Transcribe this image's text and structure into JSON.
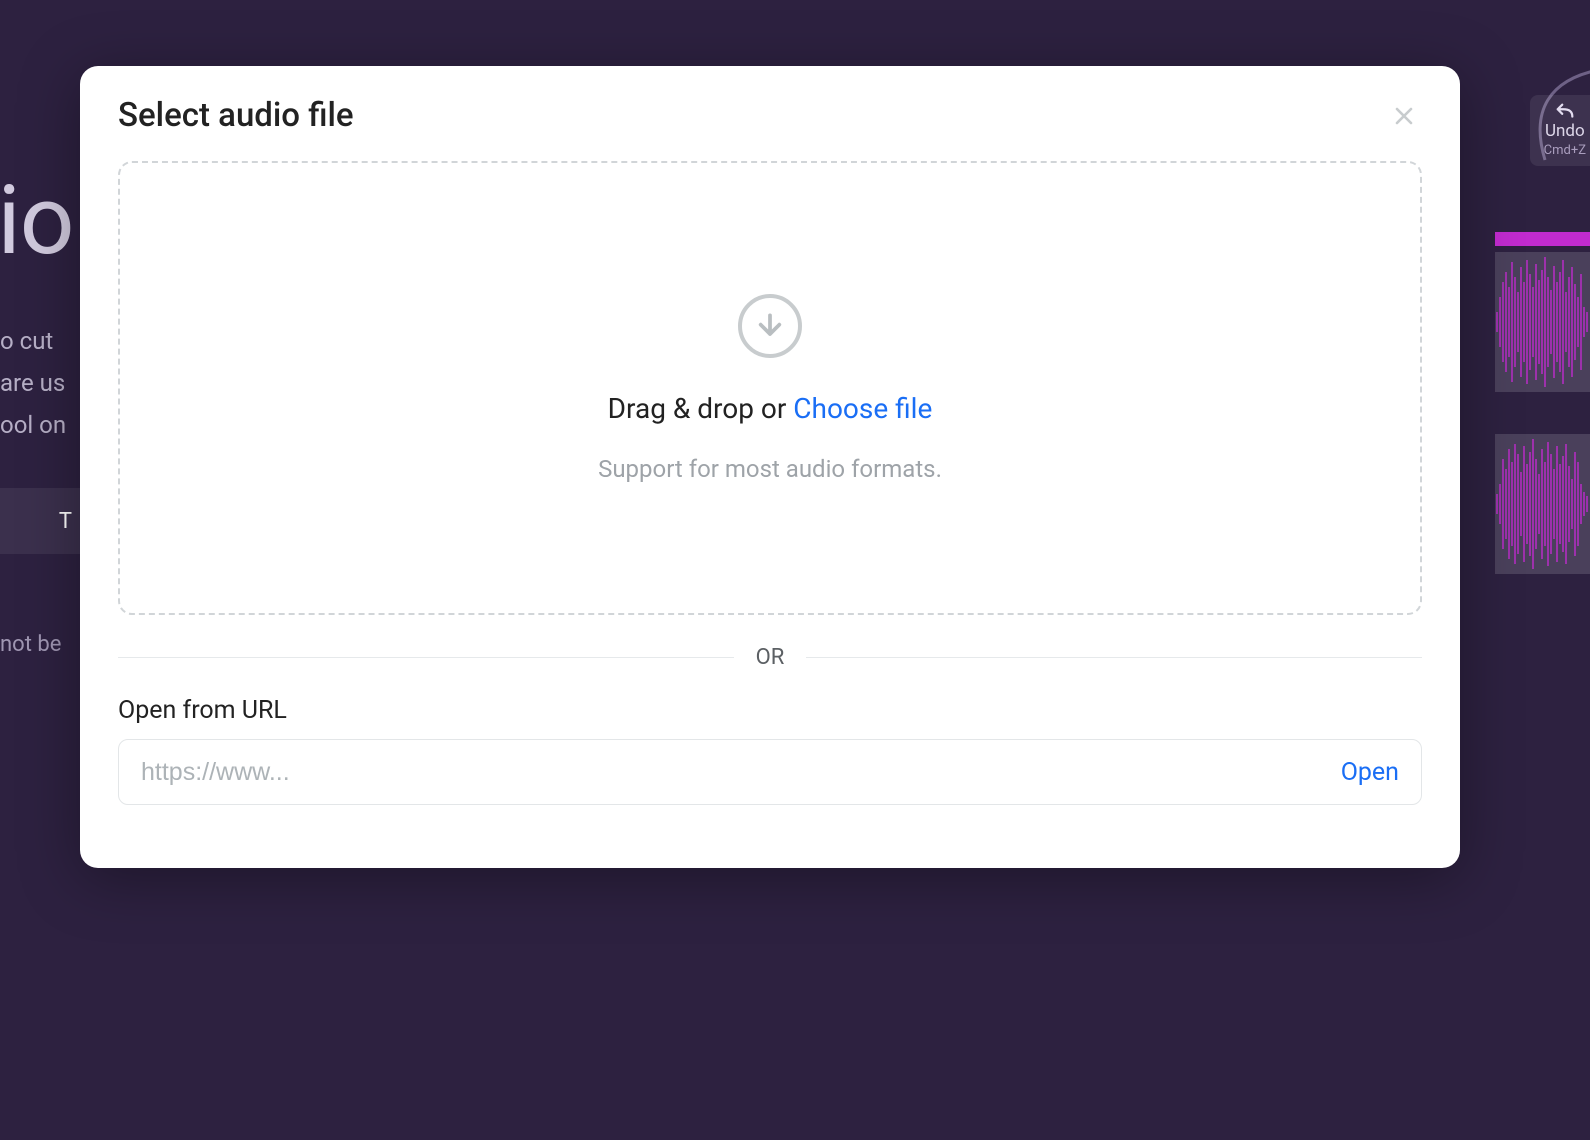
{
  "bg": {
    "undo_label": "Undo",
    "undo_shortcut": "Cmd+Z",
    "desc_line1": "o cut",
    "desc_line2": "are us",
    "desc_line3": "ool on",
    "button_stub": "T",
    "note": "not be",
    "big_title_fragment": "lio"
  },
  "modal": {
    "title": "Select audio file",
    "dropzone": {
      "main_text": "Drag & drop or ",
      "choose_file": "Choose file",
      "sub_text": "Support for most audio formats."
    },
    "divider": "OR",
    "url_section": {
      "label": "Open from URL",
      "placeholder": "https://www...",
      "open_button": "Open"
    }
  }
}
